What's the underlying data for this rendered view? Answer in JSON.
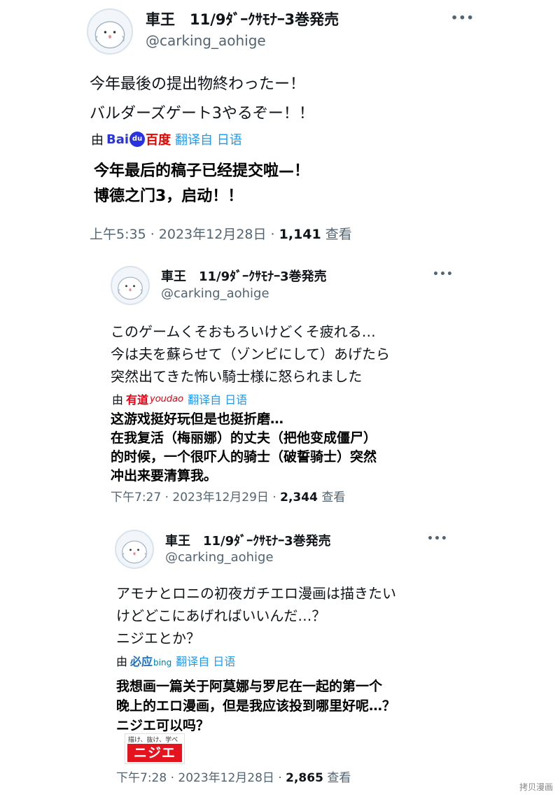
{
  "tweets": [
    {
      "author_name": "車王　11/9ﾀﾞｰｸｻﾓﾅｰ3巻発売",
      "author_handle": "@carking_aohige",
      "more_label": "•••",
      "body_lines": [
        "今年最後の提出物終わったー！",
        "バルダーズゲート3やるぞー！！"
      ],
      "translated_by": "由",
      "translator_logo": "baidu",
      "translator_logo_parts": [
        "Bai",
        "du",
        "百度"
      ],
      "translate_label": "翻译自 日语",
      "translated_lines": [
        "今年最后的稿子已经提交啦—！",
        "博德之门3，启动！！"
      ],
      "timestamp": "上午5:35 · 2023年12月28日 · ",
      "view_count": "1,141",
      "view_label": " 查看"
    },
    {
      "author_name": "車王　11/9ﾀﾞｰｸｻﾓﾅｰ3巻発売",
      "author_handle": "@carking_aohige",
      "more_label": "•••",
      "body_lines": [
        "このゲームくそおもろいけどくそ疲れる…",
        "今は夫を蘇らせて（ゾンビにして）あげたら",
        "突然出てきた怖い騎士様に怒られました"
      ],
      "translated_by": "由",
      "translator_logo": "youdao",
      "translator_logo_parts": [
        "有道",
        "youdao"
      ],
      "translate_label": "翻译自 日语",
      "translated_lines": [
        "这游戏挺好玩但是也挺折磨…",
        "在我复活（梅丽娜）的丈夫（把他变成僵尸）",
        "的时候，一个很吓人的骑士（破誓骑士）突然",
        "冲出来要清算我。"
      ],
      "timestamp": "下午7:27 · 2023年12月29日 · ",
      "view_count": "2,344",
      "view_label": " 查看"
    },
    {
      "author_name": "車王　11/9ﾀﾞｰｸｻﾓﾅｰ3巻発売",
      "author_handle": "@carking_aohige",
      "more_label": "•••",
      "body_lines": [
        "アモナとロニの初夜ガチエロ漫画は描きたい",
        "けどどこにあげればいいんだ…？",
        "ニジエとか？"
      ],
      "translated_by": "由",
      "translator_logo": "bing",
      "translator_logo_parts": [
        "必应",
        "bing"
      ],
      "translate_label": "翻译自 日语",
      "translated_lines": [
        "我想画一篇关于阿莫娜与罗尼在一起的第一个",
        "晚上的エロ漫画，但是我应该投到哪里好呢…？",
        "ニジエ可以吗？"
      ],
      "image_tagline": "描け、抜け、学べ",
      "image_word": "ニジエ",
      "timestamp": "下午7:28 · 2023年12月28日 · ",
      "view_count": "2,865",
      "view_label": " 查看"
    }
  ],
  "watermark": "拷贝漫画"
}
